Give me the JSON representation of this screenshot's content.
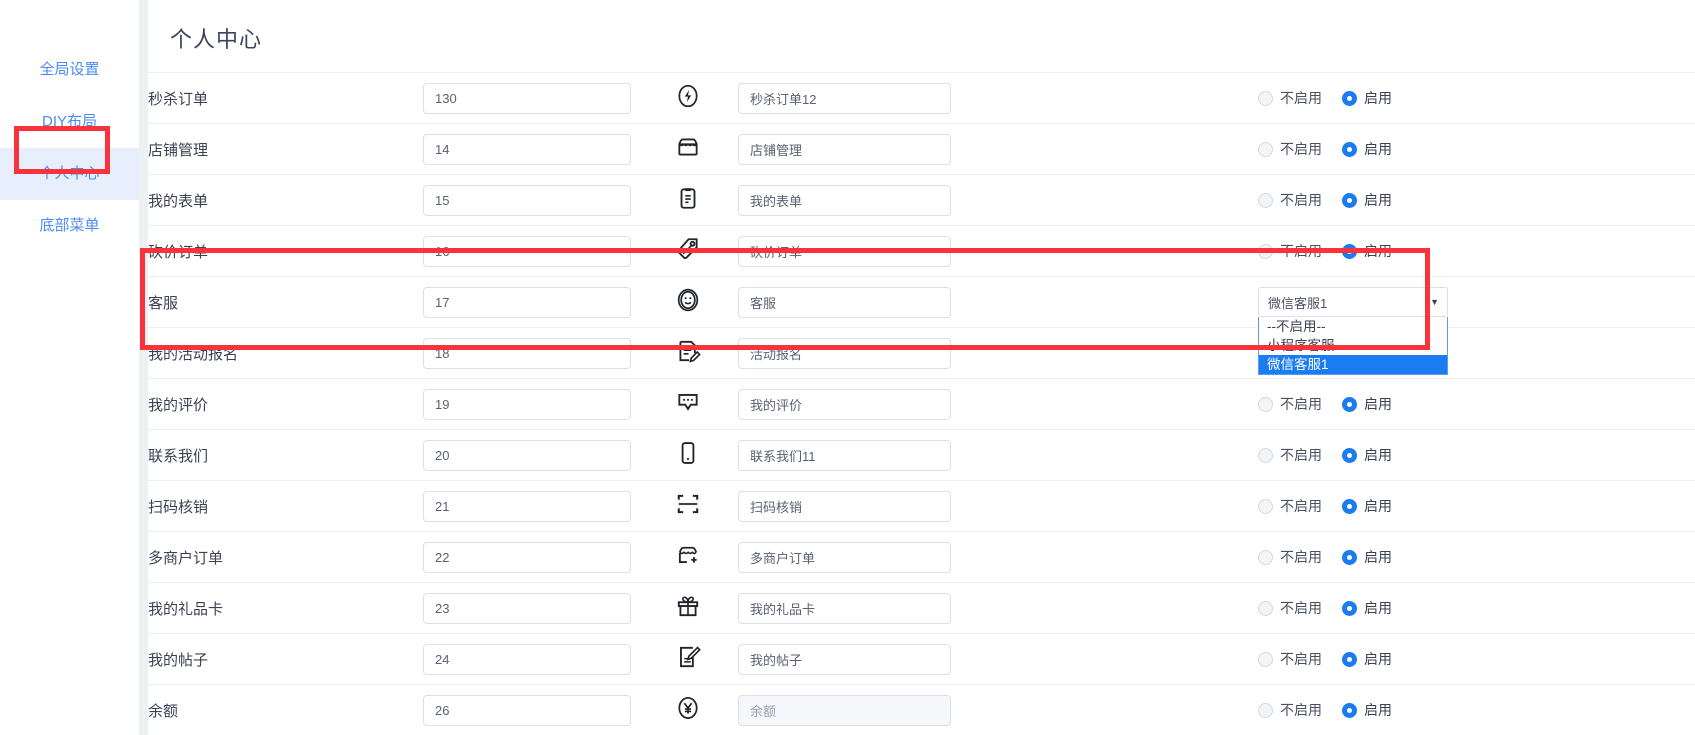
{
  "sidebar": {
    "items": [
      {
        "label": "全局设置",
        "active": false
      },
      {
        "label": "DIY布局",
        "active": false
      },
      {
        "label": "个人中心",
        "active": true
      },
      {
        "label": "底部菜单",
        "active": false
      }
    ]
  },
  "page": {
    "title": "个人中心"
  },
  "radio": {
    "off_label": "不启用",
    "on_label": "启用"
  },
  "select": {
    "value": "微信客服1",
    "caret": "chevron-down-icon",
    "options": [
      {
        "label": "--不启用--",
        "highlight": false
      },
      {
        "label": "小程序客服",
        "highlight": false
      },
      {
        "label": "微信客服1",
        "highlight": true
      }
    ]
  },
  "colors": {
    "accent": "#1a7cf0",
    "link": "#4a8bf5",
    "annotation": "#f8333c",
    "active_bg": "#e8effc",
    "border": "#ebeef2"
  },
  "rows": [
    {
      "name": "秒杀订单",
      "sort": "130",
      "icon": "lightning-icon",
      "title": "秒杀订单12",
      "status": "on",
      "control": "radio",
      "disabled": false
    },
    {
      "name": "店铺管理",
      "sort": "14",
      "icon": "shop-icon",
      "title": "店铺管理",
      "status": "on",
      "control": "radio",
      "disabled": false
    },
    {
      "name": "我的表单",
      "sort": "15",
      "icon": "clipboard-icon",
      "title": "我的表单",
      "status": "on",
      "control": "radio",
      "disabled": false
    },
    {
      "name": "砍价订单",
      "sort": "16",
      "icon": "price-tag-icon",
      "title": "砍价订单",
      "status": "on",
      "control": "radio",
      "disabled": false
    },
    {
      "name": "客服",
      "sort": "17",
      "icon": "headset-face-icon",
      "title": "客服",
      "status": "select",
      "control": "select",
      "disabled": false
    },
    {
      "name": "我的活动报名",
      "sort": "18",
      "icon": "signup-edit-icon",
      "title": "活动报名",
      "status": "none",
      "control": "none",
      "disabled": false
    },
    {
      "name": "我的评价",
      "sort": "19",
      "icon": "comment-icon",
      "title": "我的评价",
      "status": "on",
      "control": "radio",
      "disabled": false
    },
    {
      "name": "联系我们",
      "sort": "20",
      "icon": "phone-icon",
      "title": "联系我们11",
      "status": "on",
      "control": "radio",
      "disabled": false
    },
    {
      "name": "扫码核销",
      "sort": "21",
      "icon": "scan-icon",
      "title": "扫码核销",
      "status": "on",
      "control": "radio",
      "disabled": false
    },
    {
      "name": "多商户订单",
      "sort": "22",
      "icon": "shop-plus-icon",
      "title": "多商户订单",
      "status": "on",
      "control": "radio",
      "disabled": false
    },
    {
      "name": "我的礼品卡",
      "sort": "23",
      "icon": "gift-icon",
      "title": "我的礼品卡",
      "status": "on",
      "control": "radio",
      "disabled": false
    },
    {
      "name": "我的帖子",
      "sort": "24",
      "icon": "post-edit-icon",
      "title": "我的帖子",
      "status": "on",
      "control": "radio",
      "disabled": false
    },
    {
      "name": "余额",
      "sort": "26",
      "icon": "yuan-circle-icon",
      "title": "余额",
      "status": "on",
      "control": "radio",
      "disabled": true
    }
  ]
}
